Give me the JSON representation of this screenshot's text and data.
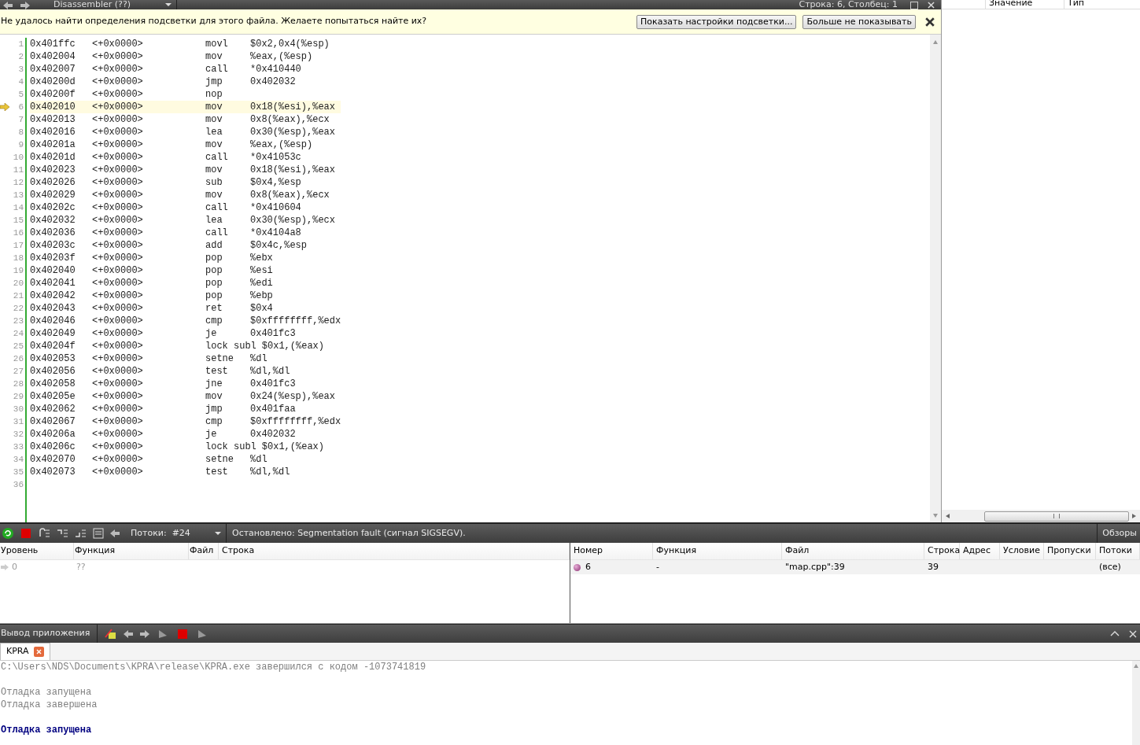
{
  "editor_bar": {
    "title": "Disassembler (??)",
    "position": "Строка: 6, Столбец: 1"
  },
  "info_bar": {
    "message": "Не удалось найти определения подсветки для этого файла. Желаете попытаться найте их?",
    "buttons": [
      "Показать настройки подсветки...",
      "Больше не показывать"
    ]
  },
  "code": [
    {
      "n": "1",
      "addr": "0x401ffc",
      "off": "<+0x0000>",
      "op": "movl",
      "args": "$0x2,0x4(%esp)",
      "current": false
    },
    {
      "n": "2",
      "addr": "0x402004",
      "off": "<+0x0000>",
      "op": "mov",
      "args": "%eax,(%esp)",
      "current": false
    },
    {
      "n": "3",
      "addr": "0x402007",
      "off": "<+0x0000>",
      "op": "call",
      "args": "*0x410440",
      "current": false
    },
    {
      "n": "4",
      "addr": "0x40200d",
      "off": "<+0x0000>",
      "op": "jmp",
      "args": "0x402032",
      "current": false
    },
    {
      "n": "5",
      "addr": "0x40200f",
      "off": "<+0x0000>",
      "op": "nop",
      "current": false
    },
    {
      "n": "6",
      "addr": "0x402010",
      "off": "<+0x0000>",
      "op": "mov",
      "args": "0x18(%esi),%eax",
      "current": true
    },
    {
      "n": "7",
      "addr": "0x402013",
      "off": "<+0x0000>",
      "op": "mov",
      "args": "0x8(%eax),%ecx",
      "current": false
    },
    {
      "n": "8",
      "addr": "0x402016",
      "off": "<+0x0000>",
      "op": "lea",
      "args": "0x30(%esp),%eax",
      "current": false
    },
    {
      "n": "9",
      "addr": "0x40201a",
      "off": "<+0x0000>",
      "op": "mov",
      "args": "%eax,(%esp)",
      "current": false
    },
    {
      "n": "10",
      "addr": "0x40201d",
      "off": "<+0x0000>",
      "op": "call",
      "args": "*0x41053c",
      "current": false
    },
    {
      "n": "11",
      "addr": "0x402023",
      "off": "<+0x0000>",
      "op": "mov",
      "args": "0x18(%esi),%eax",
      "current": false
    },
    {
      "n": "12",
      "addr": "0x402026",
      "off": "<+0x0000>",
      "op": "sub",
      "args": "$0x4,%esp",
      "current": false
    },
    {
      "n": "13",
      "addr": "0x402029",
      "off": "<+0x0000>",
      "op": "mov",
      "args": "0x8(%eax),%ecx",
      "current": false
    },
    {
      "n": "14",
      "addr": "0x40202c",
      "off": "<+0x0000>",
      "op": "call",
      "args": "*0x410604",
      "current": false
    },
    {
      "n": "15",
      "addr": "0x402032",
      "off": "<+0x0000>",
      "op": "lea",
      "args": "0x30(%esp),%ecx",
      "current": false
    },
    {
      "n": "16",
      "addr": "0x402036",
      "off": "<+0x0000>",
      "op": "call",
      "args": "*0x4104a8",
      "current": false
    },
    {
      "n": "17",
      "addr": "0x40203c",
      "off": "<+0x0000>",
      "op": "add",
      "args": "$0x4c,%esp",
      "current": false
    },
    {
      "n": "18",
      "addr": "0x40203f",
      "off": "<+0x0000>",
      "op": "pop",
      "args": "%ebx",
      "current": false
    },
    {
      "n": "19",
      "addr": "0x402040",
      "off": "<+0x0000>",
      "op": "pop",
      "args": "%esi",
      "current": false
    },
    {
      "n": "20",
      "addr": "0x402041",
      "off": "<+0x0000>",
      "op": "pop",
      "args": "%edi",
      "current": false
    },
    {
      "n": "21",
      "addr": "0x402042",
      "off": "<+0x0000>",
      "op": "pop",
      "args": "%ebp",
      "current": false
    },
    {
      "n": "22",
      "addr": "0x402043",
      "off": "<+0x0000>",
      "op": "ret",
      "args": "$0x4",
      "current": false
    },
    {
      "n": "23",
      "addr": "0x402046",
      "off": "<+0x0000>",
      "op": "cmp",
      "args": "$0xffffffff,%edx",
      "current": false
    },
    {
      "n": "24",
      "addr": "0x402049",
      "off": "<+0x0000>",
      "op": "je",
      "args": "0x401fc3",
      "current": false
    },
    {
      "n": "25",
      "addr": "0x40204f",
      "off": "<+0x0000>",
      "op": "lock subl",
      "args": "$0x1,(%eax)",
      "current": false
    },
    {
      "n": "26",
      "addr": "0x402053",
      "off": "<+0x0000>",
      "op": "setne",
      "args": "%dl",
      "current": false
    },
    {
      "n": "27",
      "addr": "0x402056",
      "off": "<+0x0000>",
      "op": "test",
      "args": "%dl,%dl",
      "current": false
    },
    {
      "n": "28",
      "addr": "0x402058",
      "off": "<+0x0000>",
      "op": "jne",
      "args": "0x401fc3",
      "current": false
    },
    {
      "n": "29",
      "addr": "0x40205e",
      "off": "<+0x0000>",
      "op": "mov",
      "args": "0x24(%esp),%eax",
      "current": false
    },
    {
      "n": "30",
      "addr": "0x402062",
      "off": "<+0x0000>",
      "op": "jmp",
      "args": "0x401faa",
      "current": false
    },
    {
      "n": "31",
      "addr": "0x402067",
      "off": "<+0x0000>",
      "op": "cmp",
      "args": "$0xffffffff,%edx",
      "current": false
    },
    {
      "n": "32",
      "addr": "0x40206a",
      "off": "<+0x0000>",
      "op": "je",
      "args": "0x402032",
      "current": false
    },
    {
      "n": "33",
      "addr": "0x40206c",
      "off": "<+0x0000>",
      "op": "lock subl",
      "args": "$0x1,(%eax)",
      "current": false
    },
    {
      "n": "34",
      "addr": "0x402070",
      "off": "<+0x0000>",
      "op": "setne",
      "args": "%dl",
      "current": false
    },
    {
      "n": "35",
      "addr": "0x402073",
      "off": "<+0x0000>",
      "op": "test",
      "args": "%dl,%dl",
      "current": false
    },
    {
      "n": "36",
      "current": false
    }
  ],
  "watch_panel": {
    "columns": [
      "Значение",
      "Тип"
    ]
  },
  "debug_toolbar": {
    "threads_label": "Потоки:",
    "thread": "#24",
    "status": "Остановлено: Segmentation fault (сигнал SIGSEGV).",
    "right_label": "Обзоры"
  },
  "stack_table": {
    "columns": [
      "Уровень",
      "Функция",
      "Файл",
      "Строка"
    ],
    "rows": [
      {
        "level": "0",
        "function": "??"
      }
    ]
  },
  "breakpoints_table": {
    "columns": [
      "Номер",
      "Функция",
      "Файл",
      "Строка",
      "Адрес",
      "Условие",
      "Пропуски",
      "Потоки"
    ],
    "rows": [
      {
        "number": "6",
        "function": "-",
        "file": "\"map.cpp\":39",
        "line": "39",
        "threads": "(все)"
      }
    ]
  },
  "output_panel": {
    "title": "Вывод приложения",
    "tabs": [
      {
        "label": "KPRA",
        "selected": true
      }
    ],
    "blocks": [
      [
        {
          "text": "C:\\Users\\NDS\\Documents\\KPRA\\release\\KPRA.exe завершился с кодом -1073741819",
          "kind": "plain"
        }
      ],
      [
        {
          "text": "Отладка запущена",
          "kind": "plain"
        },
        {
          "text": "Отладка завершена",
          "kind": "plain"
        }
      ],
      [
        {
          "text": "Отладка запущена",
          "kind": "started"
        }
      ]
    ]
  }
}
